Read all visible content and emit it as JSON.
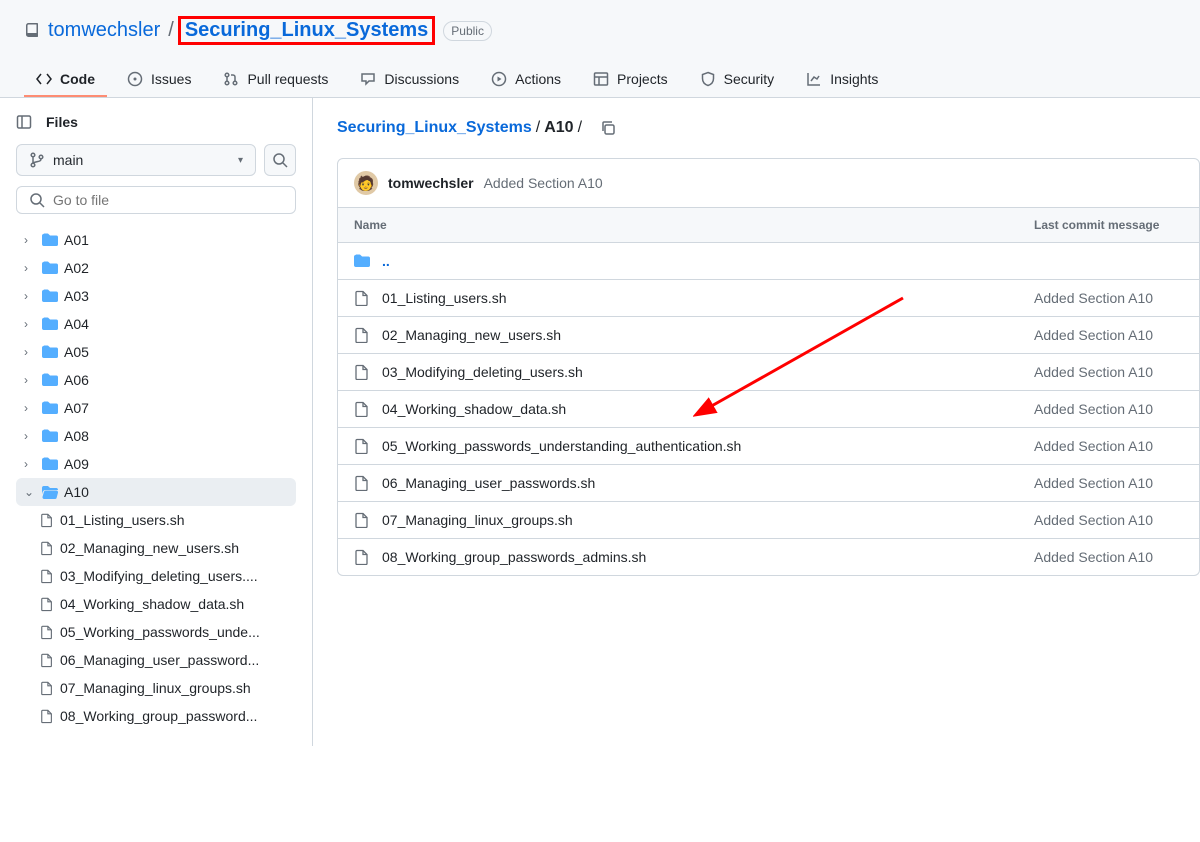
{
  "header": {
    "owner": "tomwechsler",
    "repo": "Securing_Linux_Systems",
    "visibility": "Public"
  },
  "nav": [
    {
      "label": "Code",
      "icon": "code",
      "active": true
    },
    {
      "label": "Issues",
      "icon": "issues"
    },
    {
      "label": "Pull requests",
      "icon": "pr"
    },
    {
      "label": "Discussions",
      "icon": "discuss"
    },
    {
      "label": "Actions",
      "icon": "play"
    },
    {
      "label": "Projects",
      "icon": "project"
    },
    {
      "label": "Security",
      "icon": "shield"
    },
    {
      "label": "Insights",
      "icon": "graph"
    }
  ],
  "sidebar": {
    "title": "Files",
    "branch": "main",
    "search_placeholder": "Go to file",
    "tree": [
      {
        "type": "folder",
        "label": "A01"
      },
      {
        "type": "folder",
        "label": "A02"
      },
      {
        "type": "folder",
        "label": "A03"
      },
      {
        "type": "folder",
        "label": "A04"
      },
      {
        "type": "folder",
        "label": "A05"
      },
      {
        "type": "folder",
        "label": "A06"
      },
      {
        "type": "folder",
        "label": "A07"
      },
      {
        "type": "folder",
        "label": "A08"
      },
      {
        "type": "folder",
        "label": "A09"
      },
      {
        "type": "folder",
        "label": "A10",
        "open": true,
        "active": true,
        "children": [
          {
            "type": "file",
            "label": "01_Listing_users.sh"
          },
          {
            "type": "file",
            "label": "02_Managing_new_users.sh"
          },
          {
            "type": "file",
            "label": "03_Modifying_deleting_users...."
          },
          {
            "type": "file",
            "label": "04_Working_shadow_data.sh"
          },
          {
            "type": "file",
            "label": "05_Working_passwords_unde..."
          },
          {
            "type": "file",
            "label": "06_Managing_user_password..."
          },
          {
            "type": "file",
            "label": "07_Managing_linux_groups.sh"
          },
          {
            "type": "file",
            "label": "08_Working_group_password..."
          }
        ]
      }
    ]
  },
  "breadcrumb": {
    "root": "Securing_Linux_Systems",
    "current": "A10"
  },
  "commit": {
    "author": "tomwechsler",
    "message": "Added Section A10"
  },
  "table": {
    "col_name": "Name",
    "col_commit": "Last commit message",
    "parent": "..",
    "rows": [
      {
        "name": "01_Listing_users.sh",
        "msg": "Added Section A10"
      },
      {
        "name": "02_Managing_new_users.sh",
        "msg": "Added Section A10"
      },
      {
        "name": "03_Modifying_deleting_users.sh",
        "msg": "Added Section A10"
      },
      {
        "name": "04_Working_shadow_data.sh",
        "msg": "Added Section A10"
      },
      {
        "name": "05_Working_passwords_understanding_authentication.sh",
        "msg": "Added Section A10"
      },
      {
        "name": "06_Managing_user_passwords.sh",
        "msg": "Added Section A10"
      },
      {
        "name": "07_Managing_linux_groups.sh",
        "msg": "Added Section A10"
      },
      {
        "name": "08_Working_group_passwords_admins.sh",
        "msg": "Added Section A10"
      }
    ]
  }
}
